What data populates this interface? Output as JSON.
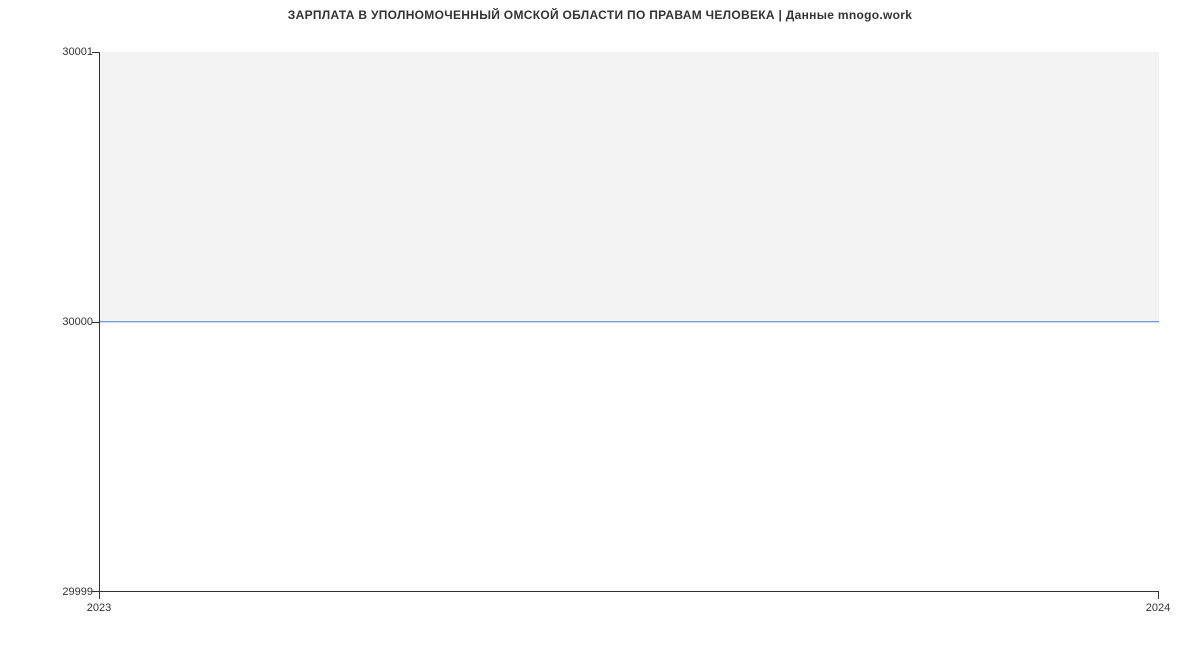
{
  "chart_data": {
    "type": "area",
    "title": "ЗАРПЛАТА В УПОЛНОМОЧЕННЫЙ ОМСКОЙ ОБЛАСТИ ПО ПРАВАМ ЧЕЛОВЕКА | Данные mnogo.work",
    "xlabel": "",
    "ylabel": "",
    "x": [
      2023,
      2024
    ],
    "values": [
      30000,
      30000
    ],
    "x_ticks": [
      "2023",
      "2024"
    ],
    "y_ticks": [
      "29999",
      "30000",
      "30001"
    ],
    "ylim": [
      29999,
      30001
    ],
    "xlim": [
      2023,
      2024
    ]
  }
}
